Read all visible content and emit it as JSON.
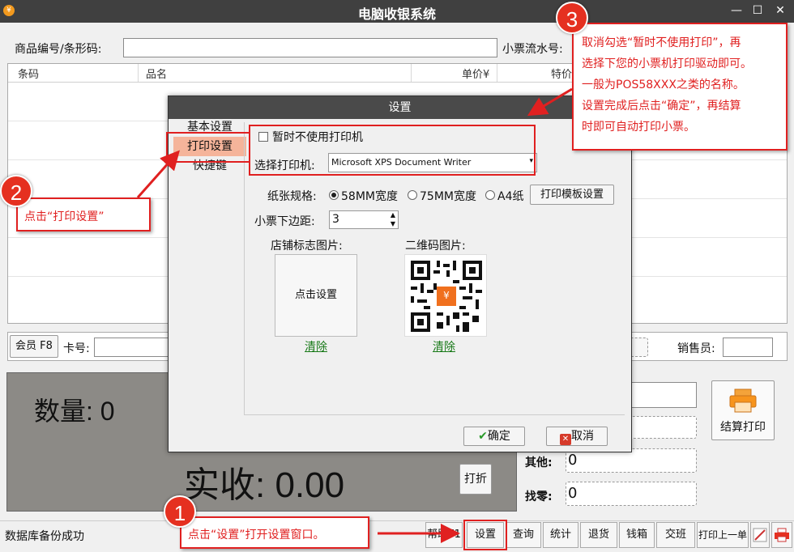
{
  "window": {
    "title": "电脑收银系统",
    "app_icon": "¥",
    "minimize": "—",
    "maximize": "☐",
    "close": "✕"
  },
  "top": {
    "barcode_label": "商品编号/条形码:",
    "receipt_label": "小票流水号:"
  },
  "grid": {
    "columns": [
      "条码",
      "品名",
      "单价¥",
      "特价"
    ]
  },
  "member": {
    "button": "会员 F8",
    "card_label": "卡号:",
    "salesperson_label": "销售员:"
  },
  "totals": {
    "quantity": "数量: 0",
    "received": "实收: 0.00",
    "discount_button": "打折"
  },
  "right_panel": {
    "other_label": "其他:",
    "other_value": "0",
    "change_label": "找零:",
    "change_value": "0",
    "checkout_button": "结算打印"
  },
  "status": {
    "text": "数据库备份成功"
  },
  "toolbar": {
    "help": "帮助F1",
    "settings": "设置",
    "query": "查询",
    "stats": "统计",
    "return": "退货",
    "cashbox": "钱箱",
    "shift": "交班",
    "reprint": "打印上一单"
  },
  "dialog": {
    "title": "设置",
    "nav": [
      "基本设置",
      "打印设置",
      "快捷键"
    ],
    "no_printer_label": "暂时不使用打印机",
    "printer_label": "选择打印机:",
    "printer_value": "Microsoft XPS Document Writer",
    "paper_label": "纸张规格:",
    "paper_options": [
      "58MM宽度",
      "75MM宽度",
      "A4纸"
    ],
    "template_button": "打印模板设置",
    "margin_label": "小票下边距:",
    "margin_value": "3",
    "logo_label": "店铺标志图片:",
    "logo_placeholder": "点击设置",
    "logo_clear": "清除",
    "qr_label": "二维码图片:",
    "qr_clear": "清除",
    "qr_center": "¥",
    "ok": "确定",
    "cancel": "取消"
  },
  "annotations": {
    "step1_number": "1",
    "step1_text": "点击“设置”打开设置窗口。",
    "step2_number": "2",
    "step2_text": "点击“打印设置”",
    "step3_number": "3",
    "step3_lines": [
      "取消勾选“暂时不使用打印”，再",
      "选择下您的小票机打印驱动即可。",
      "一般为POS58XXX之类的名称。",
      "设置完成后点击“确定”，再结算",
      "时即可自动打印小票。"
    ]
  },
  "colors": {
    "accent_red": "#e02020",
    "title_bar": "#404040",
    "totals_panel": "#8c8a86",
    "nav_selected": "#f5b49a"
  }
}
